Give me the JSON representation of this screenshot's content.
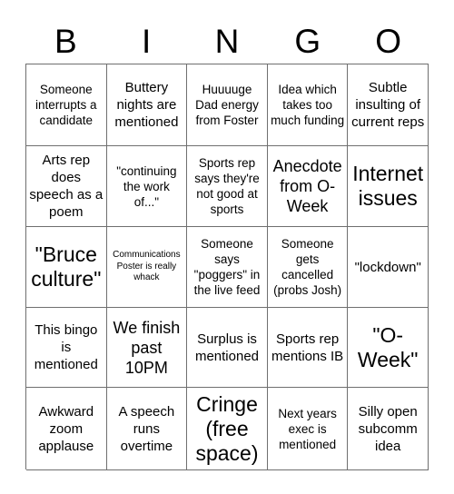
{
  "header": {
    "letters": [
      "B",
      "I",
      "N",
      "G",
      "O"
    ]
  },
  "grid": {
    "columns": 5,
    "rows": 5,
    "border_color": "#6f6f6f",
    "background_color": "#ffffff",
    "text_color": "#000000",
    "cells": [
      {
        "text": "Someone interrupts a candidate",
        "size": "sm"
      },
      {
        "text": "Buttery nights are mentioned",
        "size": "md"
      },
      {
        "text": "Huuuuge Dad energy from Foster",
        "size": "sm"
      },
      {
        "text": "Idea which takes too much funding",
        "size": "sm"
      },
      {
        "text": "Subtle insulting of current reps",
        "size": "md"
      },
      {
        "text": "Arts rep does speech as a poem",
        "size": "md"
      },
      {
        "text": "\"continuing the work of...\"",
        "size": "sm"
      },
      {
        "text": "Sports rep says they're not good at sports",
        "size": "sm"
      },
      {
        "text": "Anecdote from O-Week",
        "size": "lg"
      },
      {
        "text": "Internet issues",
        "size": "xl"
      },
      {
        "text": "\"Bruce culture\"",
        "size": "xl"
      },
      {
        "text": "Communications Poster is really whack",
        "size": "xs"
      },
      {
        "text": "Someone says \"poggers\" in the live feed",
        "size": "sm"
      },
      {
        "text": "Someone gets cancelled (probs Josh)",
        "size": "sm"
      },
      {
        "text": "\"lockdown\"",
        "size": "md"
      },
      {
        "text": "This bingo is mentioned",
        "size": "md"
      },
      {
        "text": "We finish past 10PM",
        "size": "lg"
      },
      {
        "text": "Surplus is mentioned",
        "size": "md"
      },
      {
        "text": "Sports rep mentions IB",
        "size": "md"
      },
      {
        "text": "\"O-Week\"",
        "size": "xl"
      },
      {
        "text": "Awkward zoom applause",
        "size": "md"
      },
      {
        "text": "A speech runs overtime",
        "size": "md"
      },
      {
        "text": "Cringe (free space)",
        "size": "xl"
      },
      {
        "text": "Next years exec is mentioned",
        "size": "sm"
      },
      {
        "text": "Silly open subcomm idea",
        "size": "md"
      }
    ]
  }
}
